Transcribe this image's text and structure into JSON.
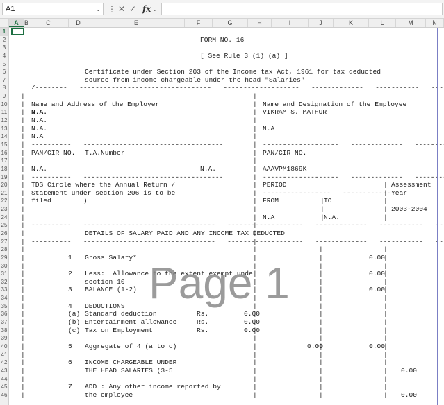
{
  "namebox": {
    "value": "A1"
  },
  "watermark": "Page 1",
  "columns": [
    "A",
    "B",
    "C",
    "D",
    "E",
    "F",
    "G",
    "H",
    "I",
    "J",
    "K",
    "L",
    "M",
    "N"
  ],
  "rows": [
    "1",
    "2",
    "3",
    "4",
    "5",
    "6",
    "7",
    "8",
    "9",
    "10",
    "11",
    "12",
    "13",
    "14",
    "15",
    "16",
    "17",
    "18",
    "19",
    "20",
    "21",
    "22",
    "23",
    "24",
    "25",
    "26",
    "27",
    "28",
    "29",
    "30",
    "31",
    "32",
    "33",
    "34",
    "35",
    "36",
    "37",
    "38",
    "39",
    "40",
    "41",
    "42",
    "43",
    "44",
    "45",
    "46"
  ],
  "sheet_lines": [
    {
      "row": 2,
      "col": "E",
      "text": "FORM NO. 16"
    },
    {
      "row": 4,
      "col": "E",
      "text": "[ See Rule 3 (1) (a) ]"
    },
    {
      "row": 6,
      "col": "D",
      "text": "Certificate under Section 203 of the Income tax Act, 1961 for tax deducted"
    },
    {
      "row": 7,
      "col": "D",
      "text": "source from income chargeable under the head \"Salaries\""
    },
    {
      "row": 8,
      "col": "A",
      "text": "/--------   ---------------------------------   -------------------   -------------   -----------   --------\\"
    },
    {
      "row": 10,
      "col": "A",
      "text": "Name and Address of the Employer"
    },
    {
      "row": 10,
      "col": "H",
      "text": "Name and Designation of the Employee"
    },
    {
      "row": 11,
      "col": "A",
      "text": "N.A."
    },
    {
      "row": 11,
      "col": "H",
      "text": "VIKRAM S. MATHUR"
    },
    {
      "row": 12,
      "col": "A",
      "text": "N.A."
    },
    {
      "row": 13,
      "col": "A",
      "text": "N.A."
    },
    {
      "row": 13,
      "col": "H",
      "text": "N.A"
    },
    {
      "row": 14,
      "col": "A",
      "text": "N.A"
    },
    {
      "row": 15,
      "col": "A",
      "text": "----------   -----------------------------------"
    },
    {
      "row": 15,
      "col": "H",
      "text": "-------------------   -------------   -----------   --------"
    },
    {
      "row": 16,
      "col": "A",
      "text": "PAN/GIR NO."
    },
    {
      "row": 16,
      "col": "D",
      "text": "T.A.Number"
    },
    {
      "row": 16,
      "col": "H",
      "text": "PAN/GIR NO."
    },
    {
      "row": 18,
      "col": "A",
      "text": "N.A."
    },
    {
      "row": 18,
      "col": "E",
      "text": "N.A."
    },
    {
      "row": 18,
      "col": "H",
      "text": "AAAVPM1869K"
    },
    {
      "row": 19,
      "col": "A",
      "text": "----------   -----------------------------------"
    },
    {
      "row": 19,
      "col": "H",
      "text": "-------------------   -------------   -----------   --------"
    },
    {
      "row": 20,
      "col": "A",
      "text": "TDS Circle where the Annual Return /"
    },
    {
      "row": 20,
      "col": "H",
      "text": "PERIOD"
    },
    {
      "row": 20,
      "col": "M",
      "text": "Assessment"
    },
    {
      "row": 21,
      "col": "A",
      "text": "Statement under section 206 is to be"
    },
    {
      "row": 21,
      "col": "H",
      "text": "-----------------   ---------------"
    },
    {
      "row": 21,
      "col": "M",
      "text": "Year"
    },
    {
      "row": 22,
      "col": "A",
      "text": "filed        )"
    },
    {
      "row": 22,
      "col": "H",
      "text": "FROM"
    },
    {
      "row": 22,
      "col": "J",
      "text": "TO"
    },
    {
      "row": 23,
      "col": "M",
      "text": "2003-2004"
    },
    {
      "row": 24,
      "col": "H",
      "text": "N.A"
    },
    {
      "row": 24,
      "col": "J",
      "text": "N.A."
    },
    {
      "row": 25,
      "col": "A",
      "text": "----------   ---------------------------------   -------------------   -------------   -----------   --------"
    },
    {
      "row": 26,
      "col": "D",
      "text": "DETAILS OF SALARY PAID AND ANY INCOME TAX DEDUCTED"
    },
    {
      "row": 27,
      "col": "A",
      "text": "----------   ---------------------------------   -------------------   -------------   -----------   --------"
    },
    {
      "row": 29,
      "col": "C",
      "text": "1"
    },
    {
      "row": 29,
      "col": "D",
      "text": "Gross Salary*"
    },
    {
      "row": 29,
      "col": "K",
      "text": "0.00"
    },
    {
      "row": 31,
      "col": "C",
      "text": "2"
    },
    {
      "row": 31,
      "col": "D",
      "text": "Less:  Allowance to the extent exempt unde"
    },
    {
      "row": 31,
      "col": "K",
      "text": "0.00"
    },
    {
      "row": 32,
      "col": "D",
      "text": "section 10"
    },
    {
      "row": 33,
      "col": "C",
      "text": "3"
    },
    {
      "row": 33,
      "col": "D",
      "text": "BALANCE (1-2)"
    },
    {
      "row": 33,
      "col": "K",
      "text": "0.00"
    },
    {
      "row": 35,
      "col": "C",
      "text": "4"
    },
    {
      "row": 35,
      "col": "D",
      "text": "DEDUCTIONS"
    },
    {
      "row": 36,
      "col": "C",
      "text": "(a)"
    },
    {
      "row": 36,
      "col": "D",
      "text": "Standard deduction"
    },
    {
      "row": 36,
      "col": "F",
      "text": "Rs."
    },
    {
      "row": 36,
      "col": "G",
      "text": "0.00"
    },
    {
      "row": 37,
      "col": "C",
      "text": "(b)"
    },
    {
      "row": 37,
      "col": "D",
      "text": "Entertainment allowance"
    },
    {
      "row": 37,
      "col": "F",
      "text": "Rs."
    },
    {
      "row": 37,
      "col": "G",
      "text": "0.00"
    },
    {
      "row": 38,
      "col": "C",
      "text": "(c)"
    },
    {
      "row": 38,
      "col": "D",
      "text": "Tax on Employment"
    },
    {
      "row": 38,
      "col": "F",
      "text": "Rs."
    },
    {
      "row": 38,
      "col": "G",
      "text": "0.00"
    },
    {
      "row": 40,
      "col": "C",
      "text": "5"
    },
    {
      "row": 40,
      "col": "D",
      "text": "Aggregate of 4 (a to c)"
    },
    {
      "row": 40,
      "col": "I",
      "text": "0.00"
    },
    {
      "row": 40,
      "col": "K",
      "text": "0.00"
    },
    {
      "row": 42,
      "col": "C",
      "text": "6"
    },
    {
      "row": 42,
      "col": "D",
      "text": "INCOME CHARGEABLE UNDER"
    },
    {
      "row": 43,
      "col": "D",
      "text": "THE HEAD SALARIES (3-5"
    },
    {
      "row": 43,
      "col": "M",
      "text": "0.00"
    },
    {
      "row": 45,
      "col": "C",
      "text": "7"
    },
    {
      "row": 45,
      "col": "D",
      "text": "ADD : Any other income reported by"
    },
    {
      "row": 46,
      "col": "D",
      "text": "the employee"
    },
    {
      "row": 46,
      "col": "M",
      "text": "0.00"
    }
  ]
}
